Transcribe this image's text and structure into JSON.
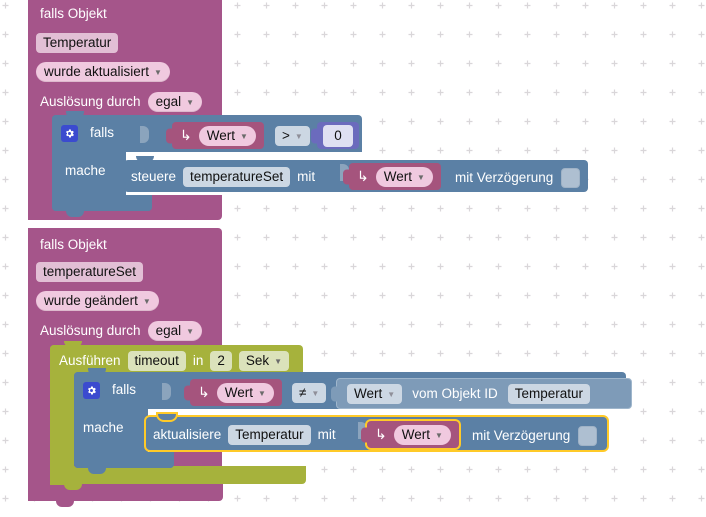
{
  "workspace": {
    "background": "#ffffff",
    "grid_color": "#d9d6d9",
    "grid_spacing": 29
  },
  "colors": {
    "event_block": "#a5558a",
    "control_block": "#5b80a5",
    "timeout_block": "#a6b23c",
    "value_block": "#a5547d",
    "logic_block": "#8aa0b8",
    "number_block": "#6b6bbd",
    "selection_outline": "#ffca28",
    "field_light": "#f0c9df",
    "field_grey": "#ccd7e3"
  },
  "blocks": [
    {
      "id": "trigger-1",
      "type": "event-trigger",
      "title": "falls Objekt",
      "object_id": "Temperatur",
      "condition_label": "wurde aktualisiert",
      "trigger_by_label": "Auslösung durch",
      "trigger_by_value": "egal",
      "body": {
        "id": "if-1",
        "type": "controls-if",
        "if_label": "falls",
        "do_label": "mache",
        "condition": {
          "left": {
            "type": "value-ref",
            "label": "Wert",
            "icon": "arrow-return-icon"
          },
          "operator": ">",
          "right": {
            "type": "number",
            "value": "0"
          }
        },
        "statement": {
          "type": "control-set",
          "verb": "steuere",
          "target": "temperatureSet",
          "with_label": "mit",
          "value": {
            "type": "value-ref",
            "label": "Wert",
            "icon": "arrow-return-icon"
          },
          "delay_label": "mit Verzögerung",
          "delay_checked": false
        }
      }
    },
    {
      "id": "trigger-2",
      "type": "event-trigger",
      "title": "falls Objekt",
      "object_id": "temperatureSet",
      "condition_label": "wurde geändert",
      "trigger_by_label": "Auslösung durch",
      "trigger_by_value": "egal",
      "body": {
        "id": "timeout-1",
        "type": "timeout",
        "run_label": "Ausführen",
        "name": "timeout",
        "in_label": "in",
        "amount": "2",
        "unit": "Sek",
        "body": {
          "id": "if-2",
          "type": "controls-if",
          "if_label": "falls",
          "do_label": "mache",
          "condition": {
            "left": {
              "type": "value-ref",
              "label": "Wert",
              "icon": "arrow-return-icon"
            },
            "operator": "≠",
            "right": {
              "type": "object-value",
              "label": "Wert",
              "of_label": "vom Objekt ID",
              "object_id": "Temperatur"
            }
          },
          "statement": {
            "type": "update-state",
            "verb": "aktualisiere",
            "target": "Temperatur",
            "with_label": "mit",
            "value": {
              "type": "value-ref",
              "label": "Wert",
              "icon": "arrow-return-icon"
            },
            "delay_label": "mit Verzögerung",
            "delay_checked": false,
            "selected": true
          }
        }
      }
    }
  ]
}
